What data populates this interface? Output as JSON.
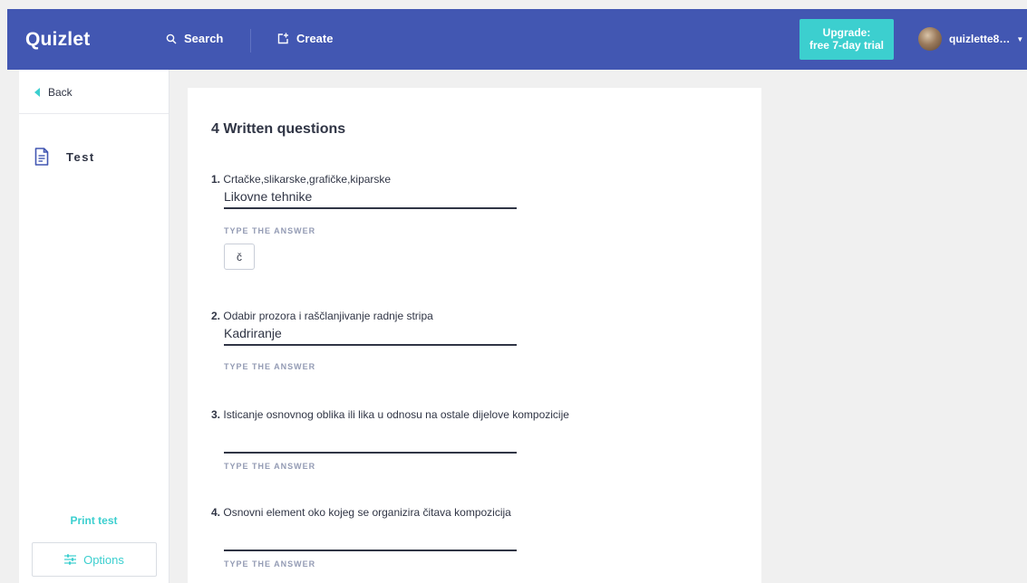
{
  "header": {
    "logo": "Quizlet",
    "search_label": "Search",
    "create_label": "Create",
    "upgrade_line1": "Upgrade:",
    "upgrade_line2": "free 7-day trial",
    "username": "quizlette8…"
  },
  "sidebar": {
    "back_label": "Back",
    "mode_label": "Test",
    "print_label": "Print test",
    "options_label": "Options"
  },
  "main": {
    "section_title": "4 Written questions",
    "type_answer_label": "TYPE THE ANSWER",
    "special_char": "č",
    "questions": [
      {
        "number": "1.",
        "text": "Crtačke,slikarske,grafičke,kiparske",
        "answer": "Likovne tehnike"
      },
      {
        "number": "2.",
        "text": "Odabir prozora i raščlanjivanje radnje stripa",
        "answer": "Kadriranje"
      },
      {
        "number": "3.",
        "text": "Isticanje osnovnog oblika ili lika u odnosu na ostale dijelove kompozicije",
        "answer": ""
      },
      {
        "number": "4.",
        "text": "Osnovni element oko kojeg se organizira čitava kompozicija",
        "answer": ""
      }
    ]
  },
  "colors": {
    "header_bg": "#4257b2",
    "accent": "#3ccfcf",
    "text": "#303545",
    "muted": "#939bb4"
  }
}
